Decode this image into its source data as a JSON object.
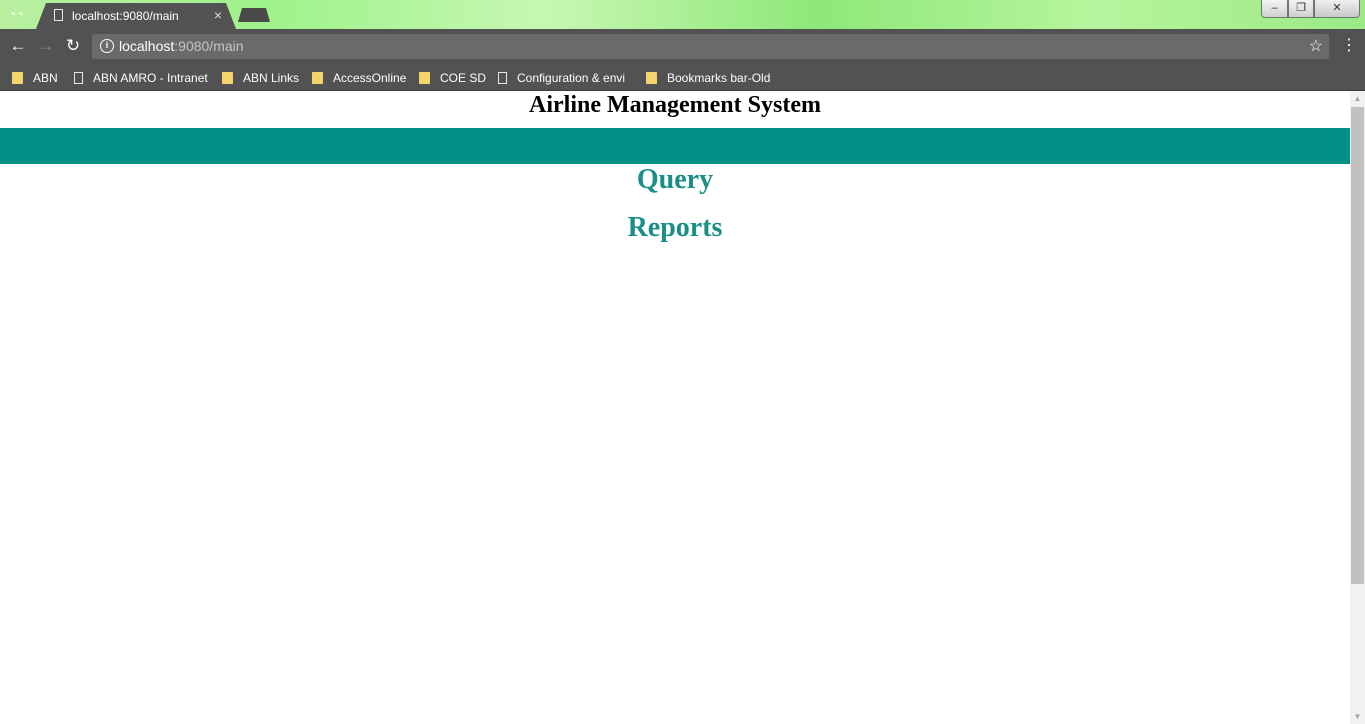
{
  "browser": {
    "tab": {
      "title": "localhost:9080/main",
      "close": "×"
    },
    "window_controls": {
      "minimize": "–",
      "maximize": "❐",
      "close": "✕"
    },
    "nav": {
      "back": "←",
      "forward": "→",
      "reload": "↻"
    },
    "address": {
      "host": "localhost",
      "rest": ":9080/main",
      "info": "i"
    },
    "star": "☆",
    "menu": "⋮",
    "bookmarks": [
      {
        "label": "ABN",
        "icon": "folder-icon"
      },
      {
        "label": "ABN AMRO - Intranet",
        "icon": "page-icon"
      },
      {
        "label": "ABN Links",
        "icon": "folder-icon"
      },
      {
        "label": "AccessOnline",
        "icon": "folder-icon"
      },
      {
        "label": "COE SD",
        "icon": "folder-icon"
      },
      {
        "label": "Configuration & envi",
        "icon": "page-icon"
      },
      {
        "label": "Bookmarks bar-Old",
        "icon": "folder-icon"
      }
    ]
  },
  "page": {
    "title": "Airline Management System",
    "banner_color": "#009086",
    "links": [
      {
        "label": "Query"
      },
      {
        "label": "Reports"
      }
    ],
    "link_color": "#1a8f87"
  },
  "scrollbar": {
    "up": "▲",
    "down": "▼"
  }
}
